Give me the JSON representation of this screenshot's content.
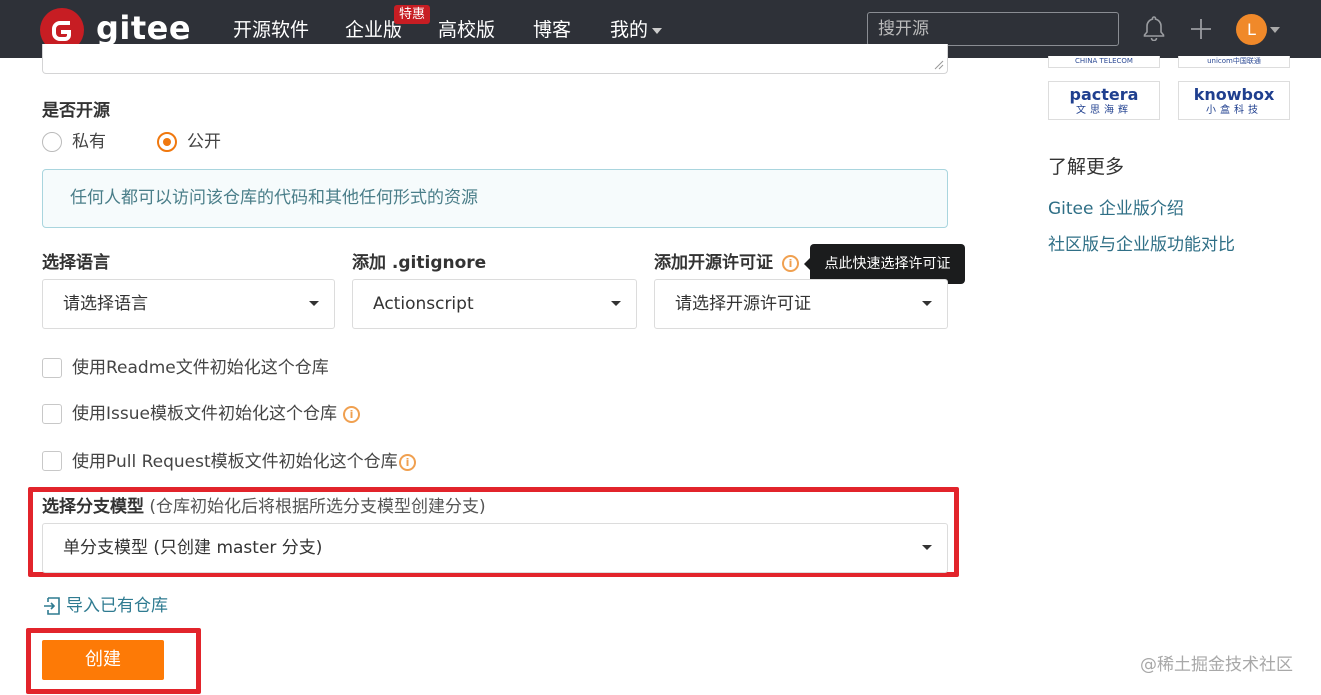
{
  "nav": {
    "logo_text": "gitee",
    "items": [
      "开源软件",
      "企业版",
      "高校版",
      "博客",
      "我的"
    ],
    "badge": "特惠",
    "search_placeholder": "搜开源",
    "avatar_letter": "L"
  },
  "form": {
    "visibility_label": "是否开源",
    "private_label": "私有",
    "public_label": "公开",
    "selected_visibility": "公开",
    "info_text": "任何人都可以访问该仓库的代码和其他任何形式的资源",
    "language_label": "选择语言",
    "language_value": "请选择语言",
    "gitignore_label": "添加 .gitignore",
    "gitignore_value": "Actionscript",
    "license_label": "添加开源许可证",
    "license_tooltip": "点此快速选择许可证",
    "license_value": "请选择开源许可证",
    "options": [
      {
        "label": "使用Readme文件初始化这个仓库",
        "checked": false,
        "has_info": false
      },
      {
        "label": "使用Issue模板文件初始化这个仓库",
        "checked": false,
        "has_info": true
      },
      {
        "label": "使用Pull Request模板文件初始化这个仓库",
        "checked": false,
        "has_info": true
      }
    ],
    "branch_label": "选择分支模型",
    "branch_hint": "(仓库初始化后将根据所选分支模型创建分支)",
    "branch_value": "单分支模型 (只创建 master 分支)",
    "import_link": "导入已有仓库",
    "create_button": "创建",
    "info_icon_glyph": "i"
  },
  "sidebar": {
    "partner_tops": [
      "CHINA TELECOM",
      "unicom中国联通"
    ],
    "partners": [
      {
        "name": "pactera",
        "sub": "文思海辉"
      },
      {
        "name": "knowbox",
        "sub": "小盒科技"
      }
    ],
    "learn_more_title": "了解更多",
    "links": [
      "Gitee 企业版介绍",
      "社区版与企业版功能对比"
    ]
  },
  "watermark": "@稀土掘金技术社区",
  "colors": {
    "topbar_bg": "#2e3138",
    "brand_red": "#c71d23",
    "accent_orange": "#fd7a06",
    "link_blue": "#2f6f86",
    "highlight_red": "#e2242b"
  }
}
